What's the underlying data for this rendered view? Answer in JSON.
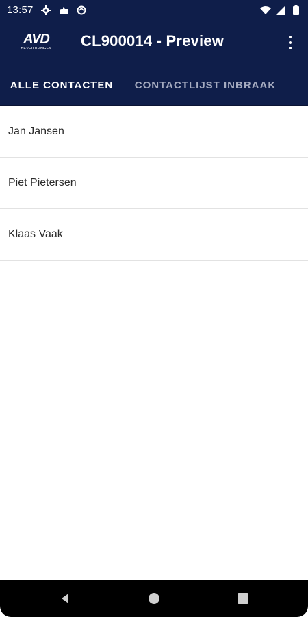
{
  "status_bar": {
    "time": "13:57",
    "icons": [
      "gear-icon",
      "cloud-icon",
      "sync-icon",
      "wifi-icon",
      "signal-icon",
      "battery-icon"
    ]
  },
  "app_bar": {
    "logo_mark": "AVD",
    "logo_sub": "BEVEILIGINGEN",
    "title": "CL900014 - Preview"
  },
  "tabs": [
    {
      "label": "ALLE CONTACTEN",
      "active": true
    },
    {
      "label": "CONTACTLIJST INBRAAK",
      "active": false
    }
  ],
  "contacts": [
    {
      "name": "Jan Jansen"
    },
    {
      "name": "Piet Pietersen"
    },
    {
      "name": "Klaas Vaak"
    }
  ],
  "colors": {
    "primary": "#0f1e4a",
    "tab_inactive": "#a4aabf",
    "text": "#2c2c2c",
    "divider": "#e2e2e2"
  }
}
